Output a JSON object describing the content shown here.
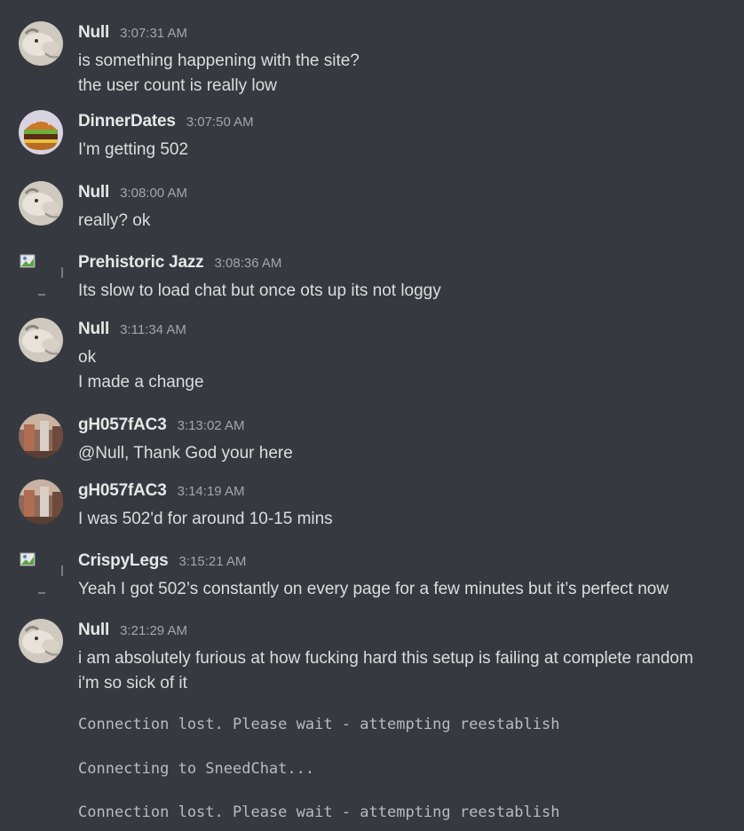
{
  "messages": [
    {
      "author": "Null",
      "time": "3:07:31 AM",
      "lines": [
        "is something happening with the site?",
        "the user count is really low"
      ]
    },
    {
      "author": "DinnerDates",
      "time": "3:07:50 AM",
      "lines": [
        "I'm getting 502"
      ]
    },
    {
      "author": "Null",
      "time": "3:08:00 AM",
      "lines": [
        "really? ok"
      ]
    },
    {
      "author": "Prehistoric Jazz",
      "time": "3:08:36 AM",
      "lines": [
        "Its slow to load chat but once ots up its not loggy"
      ]
    },
    {
      "author": "Null",
      "time": "3:11:34 AM",
      "lines": [
        "ok",
        "I made a change"
      ]
    },
    {
      "author": "gH057fAC3",
      "time": "3:13:02 AM",
      "lines": [
        "@Null, Thank God your here"
      ]
    },
    {
      "author": "gH057fAC3",
      "time": "3:14:19 AM",
      "lines": [
        "I was 502'd for around 10-15 mins"
      ]
    },
    {
      "author": "CrispyLegs",
      "time": "3:15:21 AM",
      "lines": [
        "Yeah I got 502’s constantly on every page for a few minutes but it’s perfect now"
      ]
    },
    {
      "author": "Null",
      "time": "3:21:29 AM",
      "lines": [
        "i am absolutely furious at how fucking hard this setup is failing at complete random",
        "i'm so sick of it"
      ]
    }
  ],
  "system_messages": [
    "Connection lost. Please wait - attempting reestablish",
    "Connecting to SneedChat...",
    "Connection lost. Please wait - attempting reestablish"
  ]
}
